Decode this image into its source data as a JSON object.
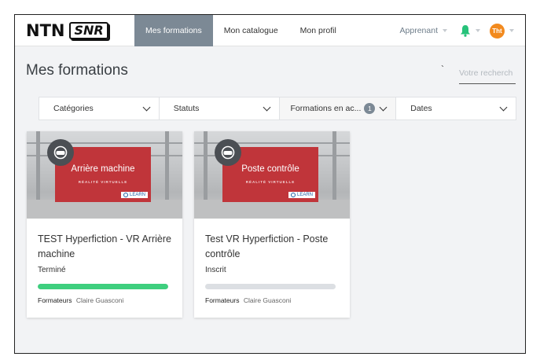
{
  "brand": {
    "ntn": "NTN",
    "snr": "SNR"
  },
  "nav": {
    "items": [
      {
        "label": "Mes formations",
        "active": true
      },
      {
        "label": "Mon catalogue",
        "active": false
      },
      {
        "label": "Mon profil",
        "active": false
      }
    ],
    "role_label": "Apprenant",
    "avatar_initials": "Tht"
  },
  "page": {
    "title": "Mes formations",
    "stray_mark": "`",
    "search_placeholder": "Votre recherch"
  },
  "filters": [
    {
      "label": "Catégories"
    },
    {
      "label": "Statuts"
    },
    {
      "label": "Formations en ac...",
      "badge": "1"
    },
    {
      "label": "Dates"
    }
  ],
  "courses": [
    {
      "banner_title": "Arrière machine",
      "banner_subtitle": "RÉALITÉ VIRTUELLE",
      "learn_tag": "LEARN",
      "title": "TEST Hyperfiction - VR Arrière machine",
      "status": "Terminé",
      "progress": 1.0,
      "trainers_label": "Formateurs",
      "trainers_name": "Claire Guasconi"
    },
    {
      "banner_title": "Poste contrôle",
      "banner_subtitle": "RÉALITÉ VIRTUELLE",
      "learn_tag": "LEARN",
      "title": "Test VR Hyperfiction - Poste contrôle",
      "status": "Inscrit",
      "progress": 0.0,
      "trainers_label": "Formateurs",
      "trainers_name": "Claire Guasconi"
    }
  ],
  "colors": {
    "nav_active": "#7c8995",
    "banner_red": "#c0353a",
    "progress_green": "#3ecf7e",
    "bell_green": "#27c27a",
    "avatar_orange": "#f28a1e"
  }
}
